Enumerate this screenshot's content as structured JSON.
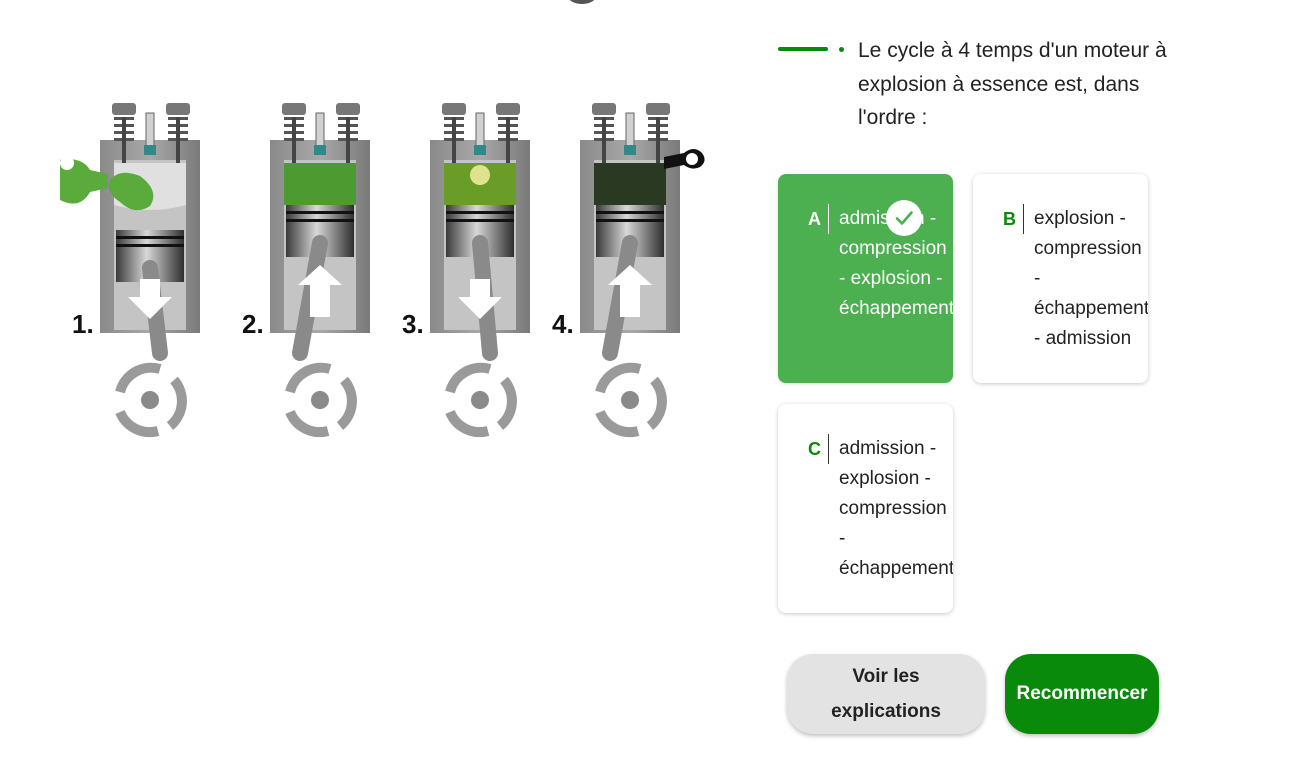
{
  "illustration": {
    "stages": [
      "1.",
      "2.",
      "3.",
      "4."
    ],
    "colors": {
      "intake": "#5aaa3c",
      "exhaust": "#111111",
      "block": "#9a9a9a",
      "arrow": "#ffffff"
    }
  },
  "question": {
    "text": "Le cycle à 4 temps d'un moteur à explosion à essence est, dans l'ordre :"
  },
  "answers": [
    {
      "letter": "A",
      "lines": [
        "admission -",
        "compression",
        "- explosion -",
        "échappement"
      ],
      "selected": true
    },
    {
      "letter": "B",
      "lines": [
        "explosion -",
        "compression",
        "-",
        "échappement",
        "- admission"
      ],
      "selected": false
    },
    {
      "letter": "C",
      "lines": [
        "admission -",
        "explosion -",
        "compression",
        "-",
        "échappement"
      ],
      "selected": false
    }
  ],
  "buttons": {
    "explain_line1": "Voir les",
    "explain_line2": "explications",
    "restart": "Recommencer"
  },
  "theme": {
    "accent": "#0a8a0a",
    "selected": "#4caf50"
  }
}
